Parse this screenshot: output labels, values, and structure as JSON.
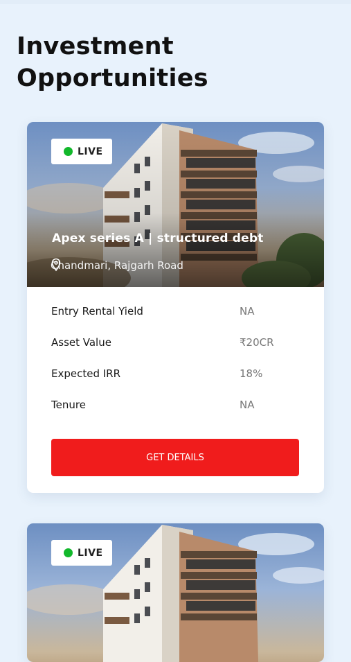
{
  "page": {
    "title": "Investment Opportunities"
  },
  "colors": {
    "background": "#e8f2fc",
    "cta": "#f01c1c",
    "live_dot": "#12b82b"
  },
  "cards": [
    {
      "badge": "LIVE",
      "title": "Apex series A | structured debt",
      "location": "Chandmari, Rajgarh Road",
      "location_icon": "map-pin-icon",
      "details": [
        {
          "label": "Entry Rental Yield",
          "value": "NA"
        },
        {
          "label": "Asset Value",
          "value": "₹20CR"
        },
        {
          "label": "Expected IRR",
          "value": "18%"
        },
        {
          "label": "Tenure",
          "value": "NA"
        }
      ],
      "cta": "GET DETAILS"
    },
    {
      "badge": "LIVE"
    }
  ]
}
